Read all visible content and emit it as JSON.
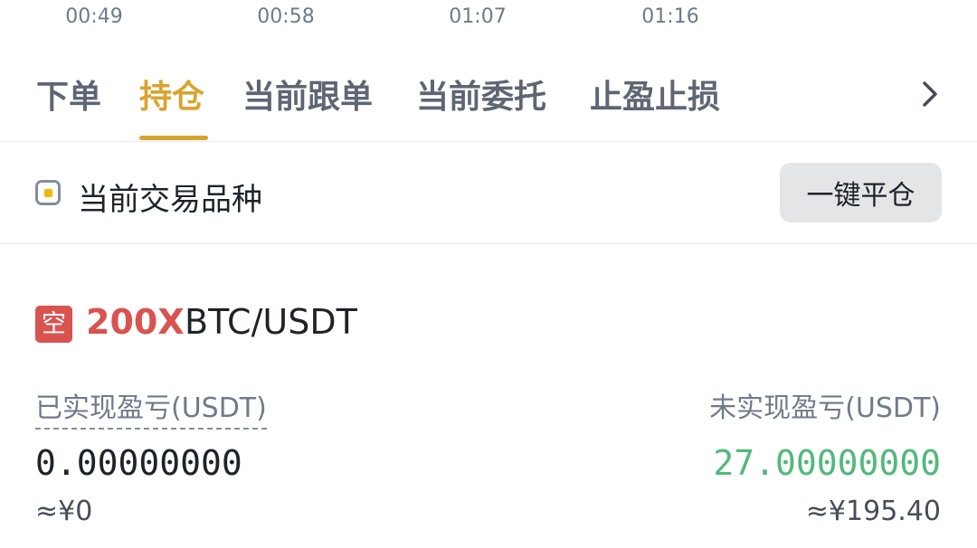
{
  "timeline": [
    "00:49",
    "00:58",
    "01:07",
    "01:16"
  ],
  "tabs": [
    {
      "label": "下单",
      "active": false
    },
    {
      "label": "持仓",
      "active": true
    },
    {
      "label": "当前跟单",
      "active": false
    },
    {
      "label": "当前委托",
      "active": false
    },
    {
      "label": "止盈止损",
      "active": false
    }
  ],
  "filter": {
    "label": "当前交易品种",
    "checked": true,
    "close_all_label": "一键平仓"
  },
  "position": {
    "side_badge": "空",
    "leverage": "200X",
    "pair": "BTC/USDT",
    "realized_pnl_label": "已实现盈亏(USDT)",
    "realized_pnl_value": "0.00000000",
    "realized_pnl_cny": "≈¥0",
    "unrealized_pnl_label": "未实现盈亏(USDT)",
    "unrealized_pnl_value": "27.00000000",
    "unrealized_pnl_cny": "≈¥195.40"
  },
  "icons": {
    "tabs_more": "chevron-right-icon"
  },
  "colors": {
    "accent": "#d8a430",
    "short": "#d9534f",
    "profit": "#52b97a"
  }
}
